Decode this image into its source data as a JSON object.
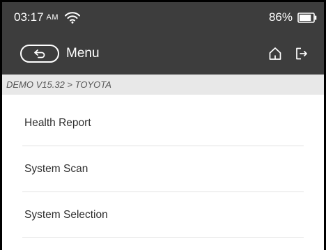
{
  "status_bar": {
    "time": "03:17",
    "ampm": "AM",
    "battery_percent": "86%",
    "battery_level": 0.86,
    "wifi_icon": "wifi-icon",
    "battery_icon": "battery-icon"
  },
  "app_bar": {
    "back_icon": "back-arrow-icon",
    "title": "Menu",
    "home_icon": "home-icon",
    "exit_icon": "exit-icon"
  },
  "breadcrumb": {
    "path": "DEMO V15.32 > TOYOTA"
  },
  "menu": {
    "items": [
      {
        "label": "Health Report"
      },
      {
        "label": "System Scan"
      },
      {
        "label": "System Selection"
      }
    ]
  },
  "colors": {
    "header_bg": "#3d3d3d",
    "breadcrumb_bg": "#e8e8e8",
    "divider": "#e2e2e2",
    "text": "#2f2f2f"
  }
}
